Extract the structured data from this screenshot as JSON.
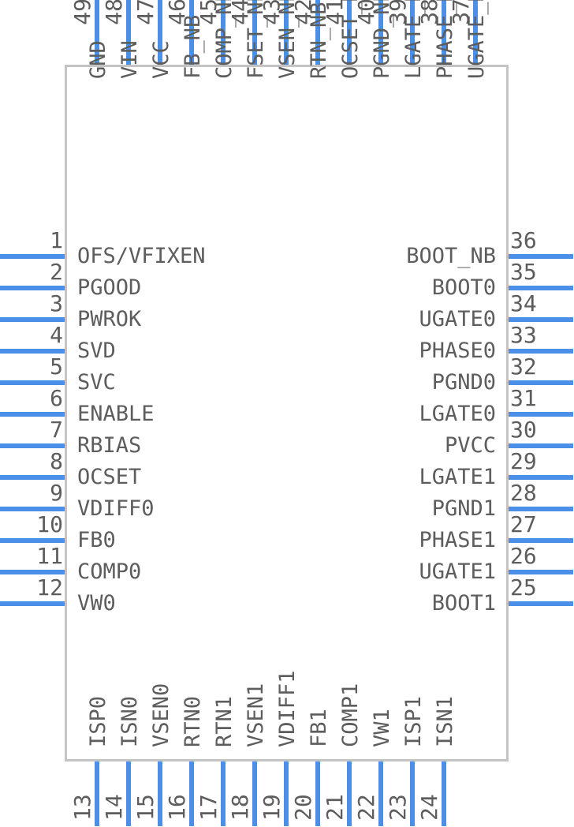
{
  "diagram": {
    "title": "IC pinout symbol",
    "package_pin_count": 49,
    "colors": {
      "pin_lead": "#4a8fe8",
      "body_border": "#c4c4c4",
      "text": "#5d5d5d",
      "background": "#ffffff"
    },
    "sides": {
      "left": {
        "name": "left-pin-row",
        "pins": [
          {
            "number": "1",
            "label": "OFS/VFIXEN"
          },
          {
            "number": "2",
            "label": "PGOOD"
          },
          {
            "number": "3",
            "label": "PWROK"
          },
          {
            "number": "4",
            "label": "SVD"
          },
          {
            "number": "5",
            "label": "SVC"
          },
          {
            "number": "6",
            "label": "ENABLE"
          },
          {
            "number": "7",
            "label": "RBIAS"
          },
          {
            "number": "8",
            "label": "OCSET"
          },
          {
            "number": "9",
            "label": "VDIFF0"
          },
          {
            "number": "10",
            "label": "FB0"
          },
          {
            "number": "11",
            "label": "COMP0"
          },
          {
            "number": "12",
            "label": "VW0"
          }
        ]
      },
      "bottom": {
        "name": "bottom-pin-row",
        "pins": [
          {
            "number": "13",
            "label": "ISP0"
          },
          {
            "number": "14",
            "label": "ISN0"
          },
          {
            "number": "15",
            "label": "VSEN0"
          },
          {
            "number": "16",
            "label": "RTN0"
          },
          {
            "number": "17",
            "label": "RTN1"
          },
          {
            "number": "18",
            "label": "VSEN1"
          },
          {
            "number": "19",
            "label": "VDIFF1"
          },
          {
            "number": "20",
            "label": "FB1"
          },
          {
            "number": "21",
            "label": "COMP1"
          },
          {
            "number": "22",
            "label": "VW1"
          },
          {
            "number": "23",
            "label": "ISP1"
          },
          {
            "number": "24",
            "label": "ISN1"
          }
        ]
      },
      "right": {
        "name": "right-pin-row",
        "pins": [
          {
            "number": "25",
            "label": "BOOT1"
          },
          {
            "number": "26",
            "label": "UGATE1"
          },
          {
            "number": "27",
            "label": "PHASE1"
          },
          {
            "number": "28",
            "label": "PGND1"
          },
          {
            "number": "29",
            "label": "LGATE1"
          },
          {
            "number": "30",
            "label": "PVCC"
          },
          {
            "number": "31",
            "label": "LGATE0"
          },
          {
            "number": "32",
            "label": "PGND0"
          },
          {
            "number": "33",
            "label": "PHASE0"
          },
          {
            "number": "34",
            "label": "UGATE0"
          },
          {
            "number": "35",
            "label": "BOOT0"
          },
          {
            "number": "36",
            "label": "BOOT_NB"
          }
        ]
      },
      "top": {
        "name": "top-pin-row",
        "pins": [
          {
            "number": "37",
            "label": "UGATE_NB"
          },
          {
            "number": "38",
            "label": "PHASE_NB"
          },
          {
            "number": "39",
            "label": "LGATE_NB"
          },
          {
            "number": "40",
            "label": "PGND_NB"
          },
          {
            "number": "41",
            "label": "OCSET_NB"
          },
          {
            "number": "42",
            "label": "RTN_NB"
          },
          {
            "number": "43",
            "label": "VSEN_NB"
          },
          {
            "number": "44",
            "label": "FSET_NB"
          },
          {
            "number": "45",
            "label": "COMP_NB"
          },
          {
            "number": "46",
            "label": "FB_NB"
          },
          {
            "number": "47",
            "label": "VCC"
          },
          {
            "number": "48",
            "label": "VIN"
          },
          {
            "number": "49",
            "label": "GND"
          }
        ]
      }
    }
  }
}
